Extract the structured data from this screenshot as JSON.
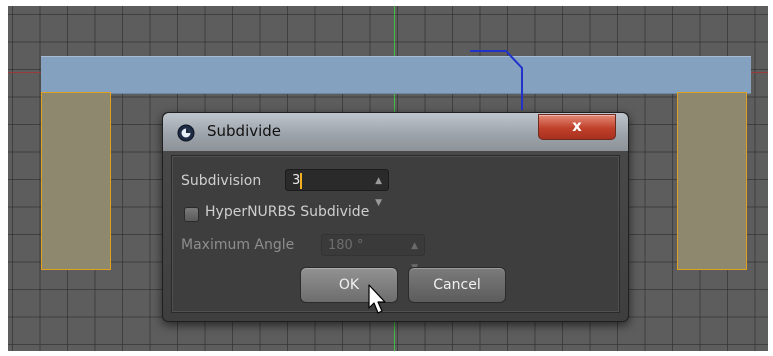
{
  "dialog": {
    "title": "Subdivide",
    "close_label": "x",
    "subdivision": {
      "label": "Subdivision",
      "value": "3"
    },
    "hypernurbs": {
      "label": "HyperNURBS Subdivide",
      "checked": false
    },
    "max_angle": {
      "label": "Maximum Angle",
      "value": "180 °",
      "enabled": false
    },
    "ok_label": "OK",
    "cancel_label": "Cancel"
  },
  "icons": {
    "app": "cinema4d-logo-icon",
    "close": "close-icon",
    "stepper": "stepper-arrows-icon",
    "cursor": "mouse-pointer-icon"
  },
  "colors": {
    "beam": "#84a1c0",
    "legs": "#8d886e",
    "leg_outline": "#e0a020",
    "close_button": "#c0412b",
    "x_axis": "#9a3a3a",
    "y_axis": "#3fbf3f"
  }
}
